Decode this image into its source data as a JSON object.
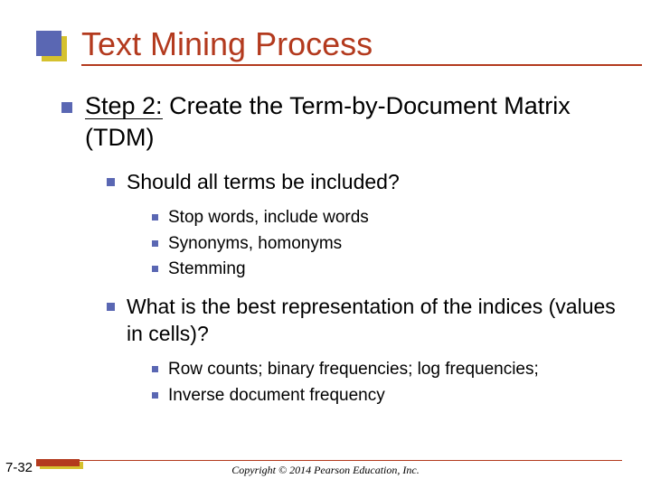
{
  "title": "Text Mining Process",
  "step_label": "Step 2:",
  "step_rest": " Create the Term-by-Document Matrix (TDM)",
  "q1": "Should all terms be included?",
  "q1_items": {
    "a": "Stop words, include words",
    "b": "Synonyms, homonyms",
    "c": "Stemming"
  },
  "q2": "What is the best representation of the indices (values in cells)?",
  "q2_items": {
    "a": "Row counts; binary frequencies; log frequencies;",
    "b": "Inverse document frequency"
  },
  "slide_number": "7-32",
  "copyright": "Copyright © 2014 Pearson Education, Inc."
}
